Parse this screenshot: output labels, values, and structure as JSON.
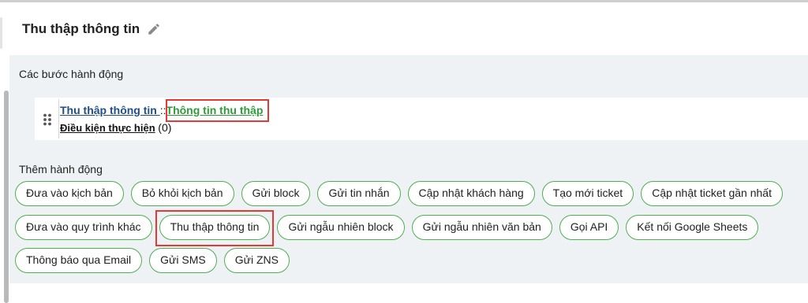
{
  "header": {
    "title": "Thu thập thông tin",
    "edit_icon": "pencil-icon"
  },
  "steps_section": {
    "label": "Các bước hành động",
    "steps": [
      {
        "action_link": "Thu thập thông tin ",
        "separator": "::",
        "target_link": "Thông tin thu thập",
        "condition_label": "Điều kiện thực hiện",
        "condition_count": "(0)",
        "drag_icon": "drag-handle-icon"
      }
    ]
  },
  "actions_section": {
    "label": "Thêm hành động",
    "rows": [
      [
        "Đưa vào kịch bản",
        "Bỏ khỏi kịch bản",
        "Gửi block",
        "Gửi tin nhắn",
        "Cập nhật khách hàng",
        "Tạo mới ticket",
        "Cập nhật ticket gần nhất"
      ],
      [
        "Đưa vào quy trình khác",
        "Thu thập thông tin",
        "Gửi ngẫu nhiên block",
        "Gửi ngẫu nhiên văn bản",
        "Gọi API",
        "Kết nối Google Sheets"
      ],
      [
        "Thông báo qua Email",
        "Gửi SMS",
        "Gửi ZNS"
      ]
    ],
    "highlighted_chip": "Thu thập thông tin"
  },
  "colors": {
    "chip_border": "#4caf50",
    "highlight_box": "#e53935",
    "panel_bg": "#eef2f5",
    "link_blue": "#1f4f86",
    "link_green": "#2e9a3a"
  }
}
